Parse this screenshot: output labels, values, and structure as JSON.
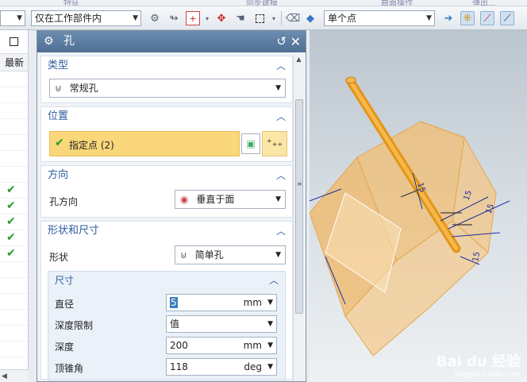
{
  "top_strip": {
    "items": [
      "特征",
      "同步建模",
      "曲面操作",
      "弹出..."
    ]
  },
  "toolbar": {
    "filter_select": "仅在工作部件内",
    "snap_select": "单个点"
  },
  "left_panel": {
    "column_header": "最新",
    "check_rows": [
      7,
      8,
      9,
      10,
      11
    ],
    "row_count": 18
  },
  "dialog": {
    "title": "孔",
    "type_section": {
      "header": "类型",
      "value": "常规孔"
    },
    "position_section": {
      "header": "位置",
      "specify_point": "指定点 (2)"
    },
    "direction_section": {
      "header": "方向",
      "label": "孔方向",
      "value": "垂直于面"
    },
    "shape_section": {
      "header": "形状和尺寸",
      "shape_label": "形状",
      "shape_value": "简单孔",
      "size_header": "尺寸",
      "rows": [
        {
          "label": "直径",
          "value": "5",
          "unit": "mm"
        },
        {
          "label": "深度限制",
          "value": "值",
          "unit": ""
        },
        {
          "label": "深度",
          "value": "200",
          "unit": "mm"
        },
        {
          "label": "顶锥角",
          "value": "118",
          "unit": "deg"
        }
      ]
    }
  },
  "viewport": {
    "dimension_labels": [
      "15",
      "15",
      "15",
      "15"
    ],
    "watermark_main": "Bai du 经验",
    "watermark_sub": "jingyan.baidu.com"
  },
  "colors": {
    "dialog_title_bg": "#5b7ca0",
    "section_header": "#2f5f9e",
    "specify_point_bg": "#f9d77a",
    "model_orange": "#f0a830",
    "model_face": "#f2be72",
    "check_green": "#2a9a2a"
  }
}
